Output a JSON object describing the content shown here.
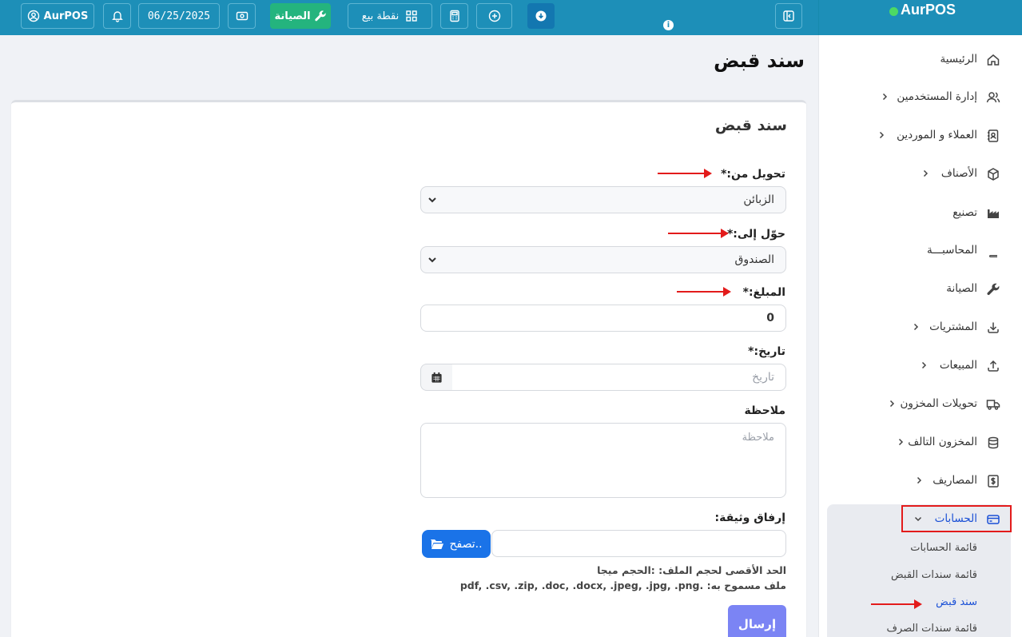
{
  "topbar": {
    "user_label": "AurPOS",
    "date": "06/25/2025",
    "maintenance_label": "الصيانة",
    "pos_label": "نقطة بيع",
    "info_glyph": "i"
  },
  "brand": {
    "name": "AurPOS"
  },
  "page": {
    "title": "سند قبض"
  },
  "form": {
    "title": "سند قبض",
    "from_label": "تحويل من:*",
    "from_value": "الزبائن",
    "to_label": "حوّل إلى:*",
    "to_value": "الصندوق",
    "amount_label": "المبلغ:*",
    "amount_value": "0",
    "date_label": "تاريخ:*",
    "date_placeholder": "تاريخ",
    "note_label": "ملاحظة",
    "note_placeholder": "ملاحظة",
    "attach_label": "إرفاق وثيقة:",
    "browse_label": "تصفح..",
    "max_size_note": "الحد الأقصى لحجم الملف: :الحجم ميجا",
    "allowed_files_note": "ملف مسموح به: .pdf, .csv, .zip, .doc, .docx, .jpeg, .jpg, .png",
    "submit_label": "إرسال"
  },
  "sidebar": {
    "items": [
      {
        "label": "الرئيسية",
        "icon": "home-icon",
        "has_children": false
      },
      {
        "label": "إدارة المستخدمين",
        "icon": "users-icon",
        "has_children": true
      },
      {
        "label": "العملاء و الموردين",
        "icon": "address-book-icon",
        "has_children": true
      },
      {
        "label": "الأصناف",
        "icon": "box-icon",
        "has_children": true
      },
      {
        "label": "تصنيع",
        "icon": "factory-icon",
        "has_children": false
      },
      {
        "label": "المحاسبـــة",
        "icon": "book-icon",
        "has_children": false
      },
      {
        "label": "الصيانة",
        "icon": "wrench-icon",
        "has_children": false
      },
      {
        "label": "المشتريات",
        "icon": "download-icon",
        "has_children": true
      },
      {
        "label": "المبيعات",
        "icon": "upload-icon",
        "has_children": true
      },
      {
        "label": "تحويلات المخزون",
        "icon": "truck-icon",
        "has_children": true
      },
      {
        "label": "المخزون التالف",
        "icon": "database-icon",
        "has_children": true
      },
      {
        "label": "المصاريف",
        "icon": "dollar-icon",
        "has_children": true
      }
    ],
    "accounts": {
      "label": "الحسابات",
      "icon": "credit-card-icon",
      "children": [
        {
          "label": "قائمة الحسابات",
          "active": false
        },
        {
          "label": "قائمة سندات القبض",
          "active": false
        },
        {
          "label": "سند قبض",
          "active": true
        },
        {
          "label": "قائمة سندات الصرف",
          "active": false
        }
      ]
    }
  },
  "colors": {
    "topbar": "#1d8fb8",
    "accent": "#1a73e8",
    "submit": "#7b84f4",
    "annotation": "#e31b1b",
    "maintenance": "#24b47e"
  }
}
